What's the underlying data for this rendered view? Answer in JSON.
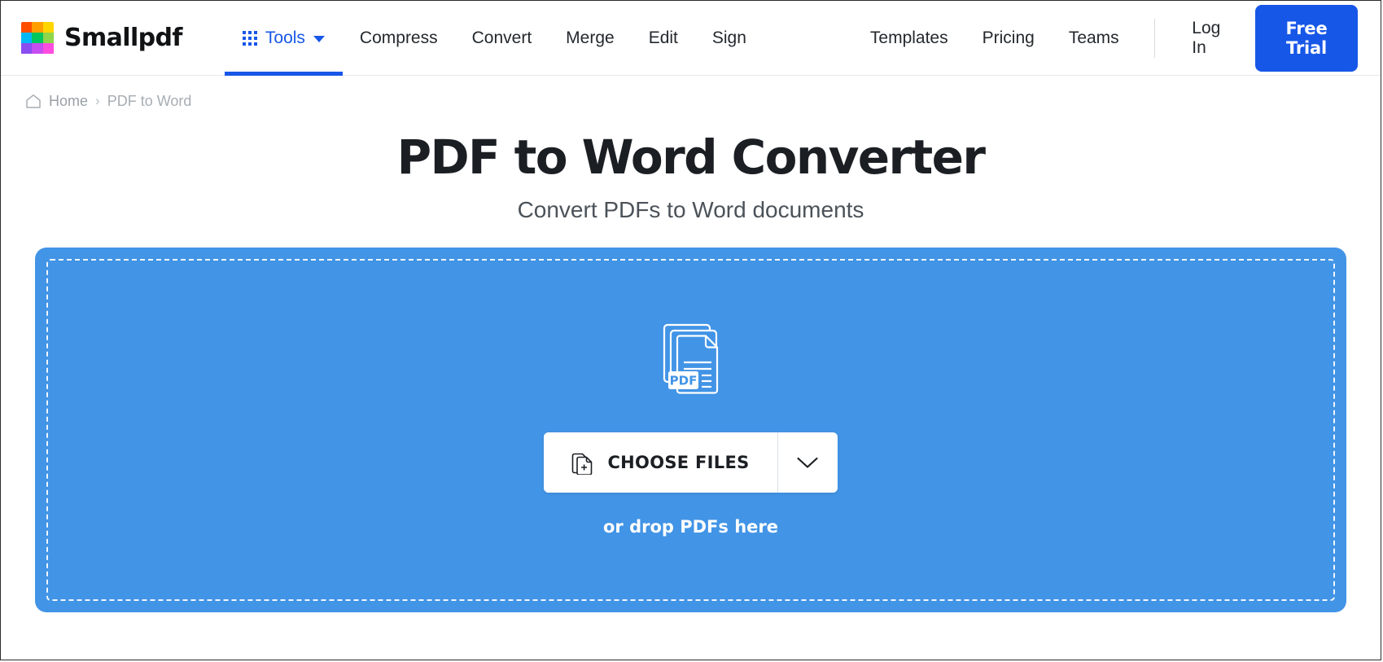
{
  "brand": {
    "name": "Smallpdf",
    "logo_colors": [
      "#ff4d00",
      "#ff9e00",
      "#ffd500",
      "#00b8f5",
      "#00c65e",
      "#8ed64a",
      "#8a4df0",
      "#c64df0",
      "#ff4de0"
    ]
  },
  "theme": {
    "accent_blue": "#1757e8",
    "dropzone_blue": "#4294e6",
    "text_dark": "#24292e",
    "muted": "#a7adb3"
  },
  "header": {
    "tools": {
      "label": "Tools",
      "icon": "grid-dots-icon",
      "caret_icon": "caret-down-icon",
      "active": true
    },
    "nav_primary": [
      {
        "label": "Compress"
      },
      {
        "label": "Convert"
      },
      {
        "label": "Merge"
      },
      {
        "label": "Edit"
      },
      {
        "label": "Sign"
      }
    ],
    "nav_secondary": [
      {
        "label": "Templates"
      },
      {
        "label": "Pricing"
      },
      {
        "label": "Teams"
      }
    ],
    "login_label": "Log In",
    "trial_label": "Free Trial"
  },
  "breadcrumb": {
    "home_icon": "home-icon",
    "home_label": "Home",
    "separator": "›",
    "current_label": "PDF to Word"
  },
  "hero": {
    "title": "PDF to Word Converter",
    "subtitle": "Convert PDFs to Word documents"
  },
  "dropzone": {
    "file_icon": "pdf-documents-stack-icon",
    "file_icon_label": "PDF",
    "choose_icon": "file-add-icon",
    "choose_label": "CHOOSE FILES",
    "caret_icon": "chevron-down-icon",
    "drop_hint": "or drop PDFs here"
  }
}
